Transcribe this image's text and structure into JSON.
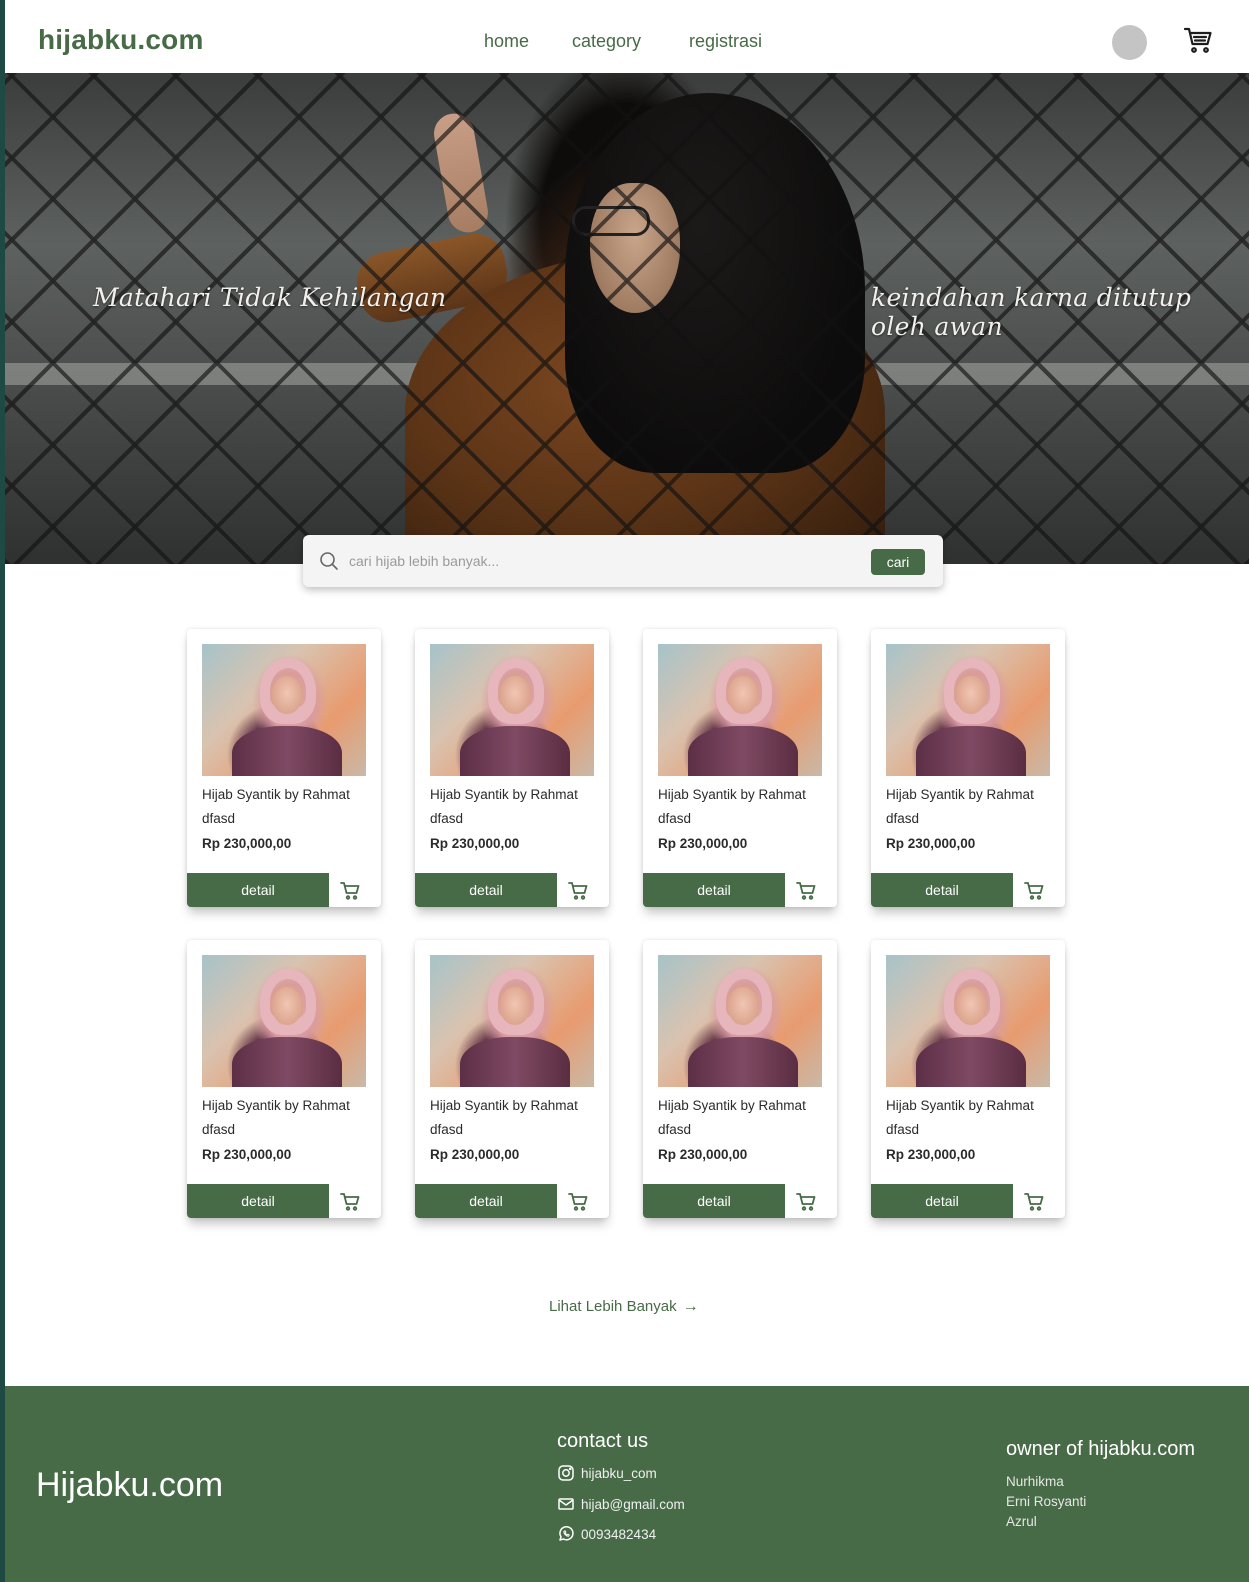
{
  "header": {
    "logo": "hijabku.com",
    "nav": [
      {
        "label": "home"
      },
      {
        "label": "category"
      },
      {
        "label": "registrasi"
      }
    ]
  },
  "hero": {
    "left_text": "Matahari Tidak Kehilangan",
    "right_text": "keindahan karna ditutup oleh awan"
  },
  "search": {
    "placeholder": "cari hijab lebih banyak...",
    "button_label": "cari"
  },
  "products": [
    {
      "title": "Hijab Syantik by Rahmat",
      "subtitle": "dfasd",
      "price": "Rp 230,000,00",
      "button": "detail"
    },
    {
      "title": "Hijab Syantik by Rahmat",
      "subtitle": "dfasd",
      "price": "Rp 230,000,00",
      "button": "detail"
    },
    {
      "title": "Hijab Syantik by Rahmat",
      "subtitle": "dfasd",
      "price": "Rp 230,000,00",
      "button": "detail"
    },
    {
      "title": "Hijab Syantik by Rahmat",
      "subtitle": "dfasd",
      "price": "Rp 230,000,00",
      "button": "detail"
    },
    {
      "title": "Hijab Syantik by Rahmat",
      "subtitle": "dfasd",
      "price": "Rp 230,000,00",
      "button": "detail"
    },
    {
      "title": "Hijab Syantik by Rahmat",
      "subtitle": "dfasd",
      "price": "Rp 230,000,00",
      "button": "detail"
    },
    {
      "title": "Hijab Syantik by Rahmat",
      "subtitle": "dfasd",
      "price": "Rp 230,000,00",
      "button": "detail"
    },
    {
      "title": "Hijab Syantik by Rahmat",
      "subtitle": "dfasd",
      "price": "Rp 230,000,00",
      "button": "detail"
    }
  ],
  "more_link": "Lihat Lebih Banyak",
  "footer": {
    "brand": "Hijabku.com",
    "contact_title": "contact us",
    "contacts": [
      {
        "icon": "instagram-icon",
        "text": "hijabku_com"
      },
      {
        "icon": "mail-icon",
        "text": "hijab@gmail.com"
      },
      {
        "icon": "whatsapp-icon",
        "text": "0093482434"
      }
    ],
    "owner_title": "owner of hijabku.com",
    "owners": [
      "Nurhikma",
      "Erni Rosyanti",
      "Azrul"
    ]
  },
  "colors": {
    "brand_green": "#476b47",
    "frame": "#1f4a44",
    "avatar_gray": "#c4c4c4"
  }
}
